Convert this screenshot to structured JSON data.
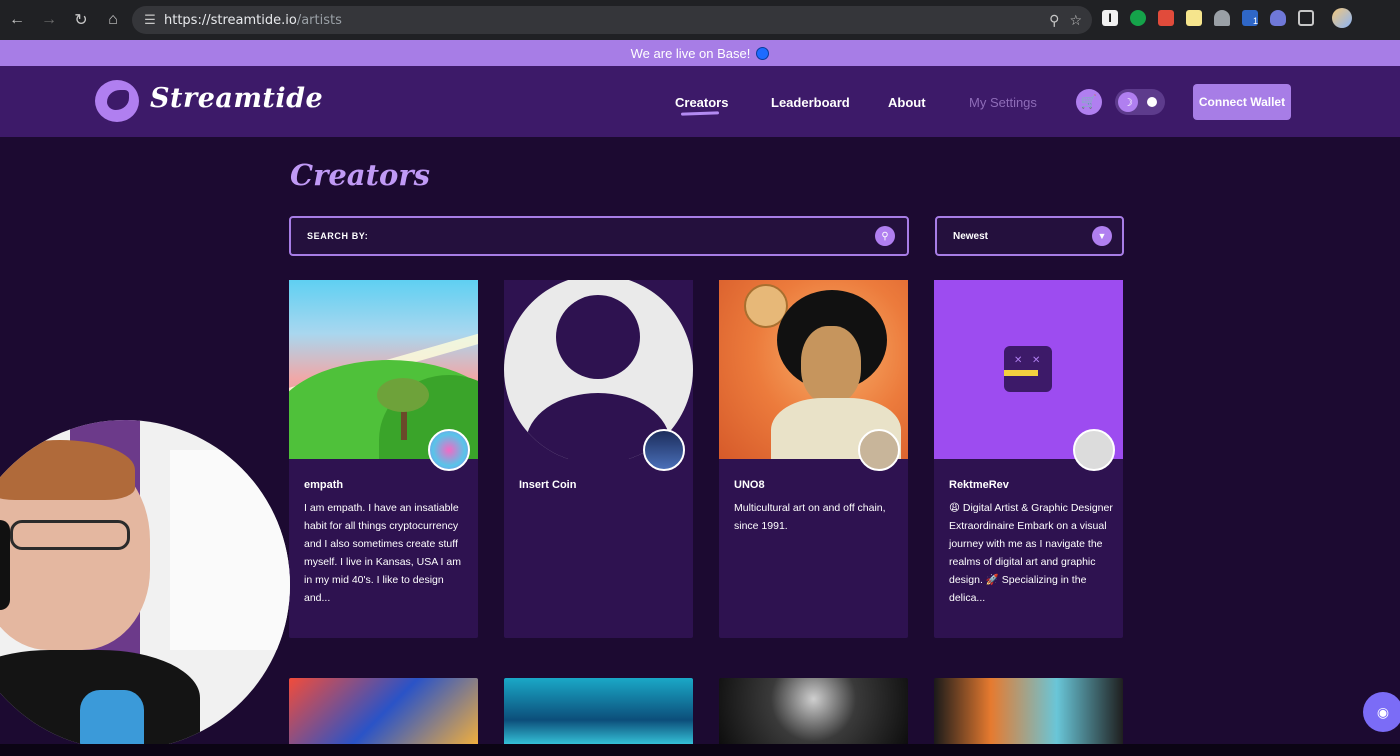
{
  "browser": {
    "url_host": "https://streamtide.io",
    "url_path": "/artists",
    "extension_badge": "1"
  },
  "banner": {
    "text": "We are live on Base!"
  },
  "header": {
    "brand": "Streamtide",
    "nav": [
      {
        "label": "Creators",
        "active": true
      },
      {
        "label": "Leaderboard",
        "active": false
      },
      {
        "label": "About",
        "active": false
      },
      {
        "label": "My Settings",
        "active": false,
        "muted": true
      }
    ],
    "connect_label": "Connect Wallet"
  },
  "main": {
    "title": "Creators",
    "search": {
      "label": "SEARCH BY:",
      "value": "",
      "placeholder": ""
    },
    "sort": {
      "value": "Newest"
    },
    "cards": [
      {
        "name": "empath",
        "bio": "I am empath. I have an insatiable habit for all things cryptocurrency and I also sometimes create stuff myself. I live in Kansas, USA I am in my mid 40's. I like to design and..."
      },
      {
        "name": "Insert Coin",
        "bio": ""
      },
      {
        "name": "UNO8",
        "bio": "Multicultural art on and off chain, since 1991."
      },
      {
        "name": "RektmeRev",
        "bio": "😩 Digital Artist & Graphic Designer Extraordinaire Embark on a visual journey with me as I navigate the realms of digital art and graphic design. 🚀 Specializing in the delica..."
      }
    ]
  },
  "colors": {
    "page_bg": "#1c0a31",
    "header_bg": "#3d1a69",
    "accent": "#a77de6",
    "card_bg": "#2e1250"
  },
  "icons": [
    "back-arrow-icon",
    "forward-arrow-icon",
    "reload-icon",
    "home-icon",
    "site-info-icon",
    "zoom-icon",
    "star-icon",
    "cart-icon",
    "moon-icon",
    "search-icon",
    "chevron-down-icon",
    "discord-icon"
  ]
}
